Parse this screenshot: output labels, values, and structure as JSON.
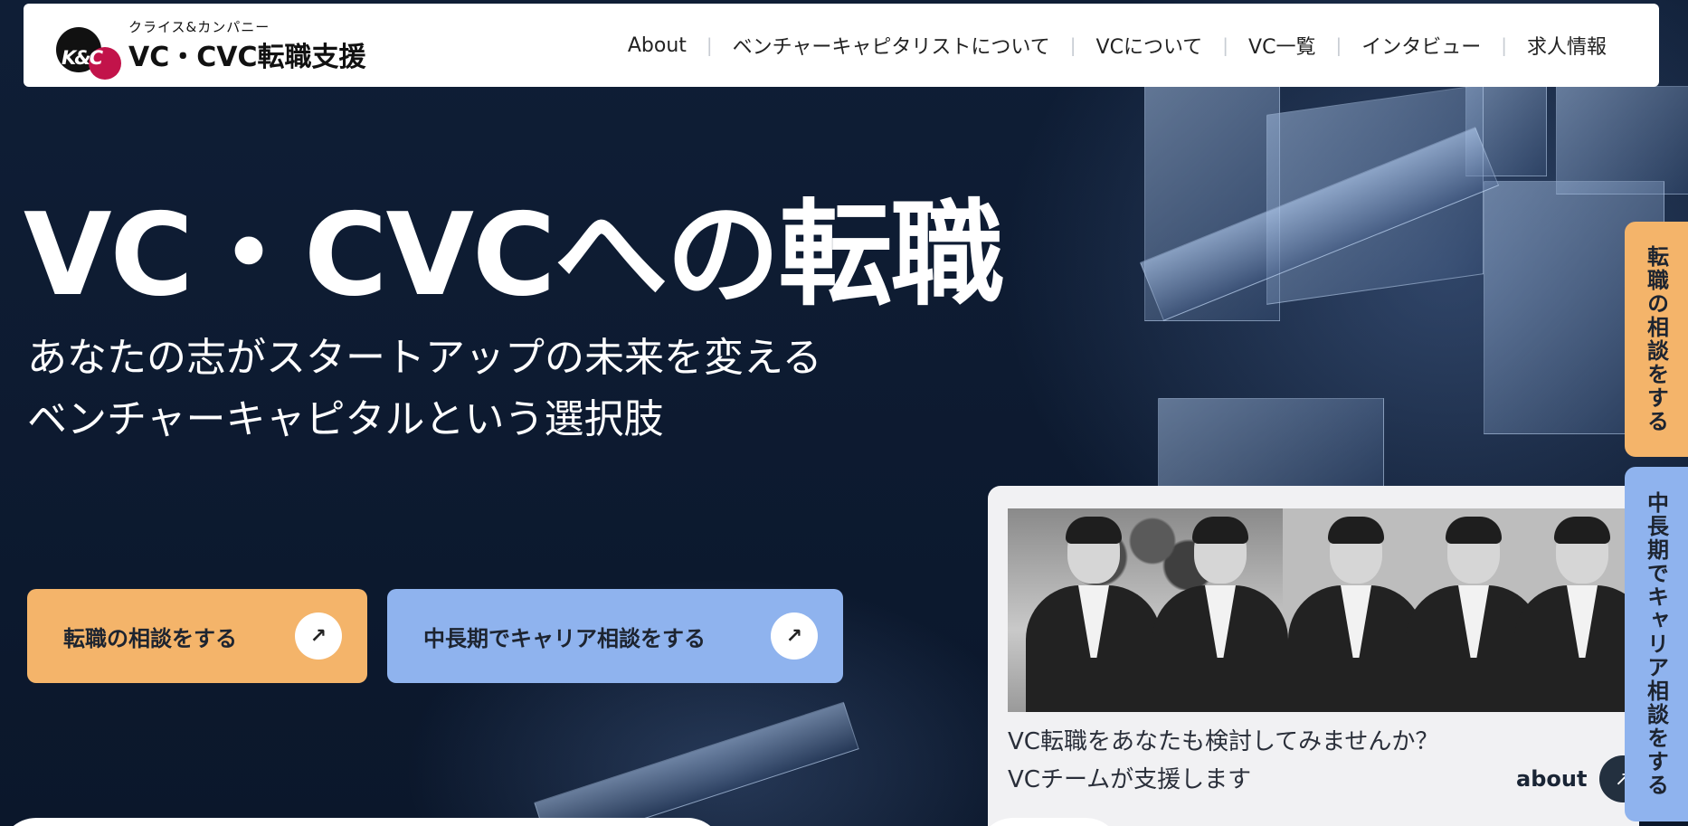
{
  "header": {
    "logo_mark_text": "K&C",
    "logo_subtitle": "クライス&カンパニー",
    "logo_title": "VC・CVC転職支援",
    "nav": [
      {
        "label": "About"
      },
      {
        "label": "ベンチャーキャピタリストについて"
      },
      {
        "label": "VCについて"
      },
      {
        "label": "VC一覧"
      },
      {
        "label": "インタビュー"
      },
      {
        "label": "求人情報"
      }
    ]
  },
  "hero": {
    "title": "VC・CVCへの転職",
    "subtitle_line1": "あなたの志がスタートアップの未来を変える",
    "subtitle_line2": "ベンチャーキャピタルという選択肢",
    "btn_primary": "転職の相談をする",
    "btn_secondary": "中長期でキャリア相談をする",
    "arrow_glyph": "↗"
  },
  "card": {
    "line1": "VC転職をあなたも検討してみませんか？",
    "line2": "VCチームが支援します",
    "link_label": "about",
    "arrow_glyph": "↗"
  },
  "side_tabs": {
    "tab1": "転職の相談をする",
    "tab2": "中長期でキャリア相談をする"
  },
  "colors": {
    "accent_orange": "#f4b46a",
    "accent_blue": "#8fb3ee",
    "background_navy": "#0d1a30",
    "logo_red": "#c2134a"
  }
}
